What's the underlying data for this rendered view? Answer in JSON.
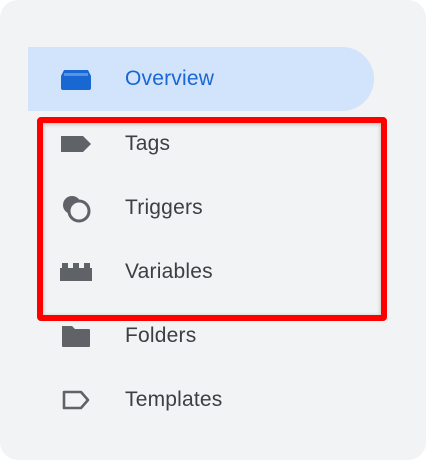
{
  "nav": {
    "items": [
      {
        "label": "Overview",
        "icon": "overview-icon",
        "active": true
      },
      {
        "label": "Tags",
        "icon": "tag-icon",
        "active": false
      },
      {
        "label": "Triggers",
        "icon": "trigger-icon",
        "active": false
      },
      {
        "label": "Variables",
        "icon": "variables-icon",
        "active": false
      },
      {
        "label": "Folders",
        "icon": "folder-icon",
        "active": false
      },
      {
        "label": "Templates",
        "icon": "template-icon",
        "active": false
      }
    ]
  },
  "colors": {
    "panel_bg": "#f1f3f4",
    "active_bg": "#d2e3fc",
    "active_text": "#1967d2",
    "icon_gray": "#5f6368",
    "highlight": "#ff0000"
  }
}
